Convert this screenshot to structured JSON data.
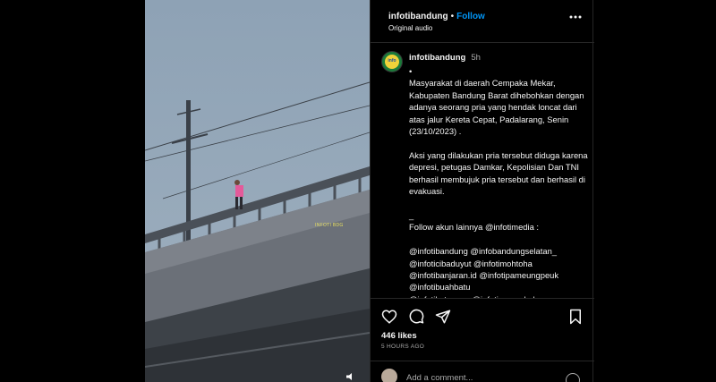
{
  "header": {
    "username": "infotibandung",
    "separator": "•",
    "follow_label": "Follow",
    "audio_label": "Original audio"
  },
  "media": {
    "watermark": "INFOTI BDG"
  },
  "caption": {
    "username": "infotibandung",
    "time": "5h",
    "body": "•\nMasyarakat di daerah Cempaka Mekar, Kabupaten Bandung Barat dihebohkan dengan adanya seorang pria yang hendak loncat dari atas jalur Kereta Cepat, Padalarang, Senin (23/10/2023) .\n\nAksi yang dilakukan pria tersebut diduga karena depresi, petugas Damkar, Kepolisian Dan TNI berhasil membujuk pria tersebut dan berhasil di evakuasi.\n\n_\nFollow akun lainnya @infotimedia :\n\n@infotibandung @infobandungselatan_\n@infoticibaduyut @infotimohtoha\n@infotibanjaran.id @infotipameungpeuk\n@infotibuahbatu\n@infotikatapang @infotirancaekek"
  },
  "actions": {
    "likes": "446 likes",
    "time_ago": "5 HOURS AGO"
  },
  "comment": {
    "placeholder": "Add a comment..."
  },
  "colors": {
    "background": "#000000",
    "accent": "#0095f6",
    "muted": "#a8a8a8",
    "border": "#262626"
  },
  "icons": [
    "heart-icon",
    "comment-icon",
    "share-icon",
    "bookmark-icon",
    "more-icon",
    "emoji-icon",
    "audio-icon"
  ]
}
